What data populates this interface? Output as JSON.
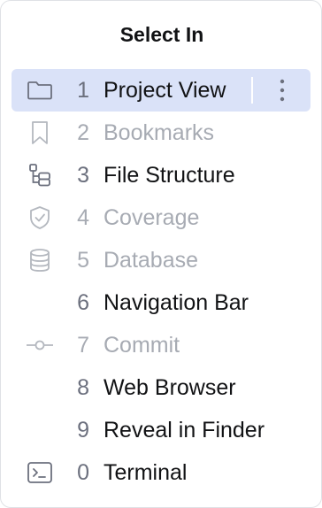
{
  "popup": {
    "title": "Select In"
  },
  "items": [
    {
      "number": "1",
      "label": "Project View",
      "icon": "folder-icon",
      "enabled": true,
      "selected": true
    },
    {
      "number": "2",
      "label": "Bookmarks",
      "icon": "bookmark-icon",
      "enabled": false
    },
    {
      "number": "3",
      "label": "File Structure",
      "icon": "structure-icon",
      "enabled": true
    },
    {
      "number": "4",
      "label": "Coverage",
      "icon": "shield-icon",
      "enabled": false
    },
    {
      "number": "5",
      "label": "Database",
      "icon": "database-icon",
      "enabled": false
    },
    {
      "number": "6",
      "label": "Navigation Bar",
      "icon": "",
      "enabled": true
    },
    {
      "number": "7",
      "label": "Commit",
      "icon": "commit-icon",
      "enabled": false
    },
    {
      "number": "8",
      "label": "Web Browser",
      "icon": "",
      "enabled": true
    },
    {
      "number": "9",
      "label": "Reveal in Finder",
      "icon": "",
      "enabled": true
    },
    {
      "number": "0",
      "label": "Terminal",
      "icon": "terminal-icon",
      "enabled": true
    }
  ],
  "colors": {
    "selected_row": "#dae2f8",
    "text": "#111214",
    "disabled_text": "#a7abb3",
    "number_text": "#6c707e",
    "icon_stroke": "#6c707e",
    "disabled_icon_stroke": "#b4b8bf"
  }
}
